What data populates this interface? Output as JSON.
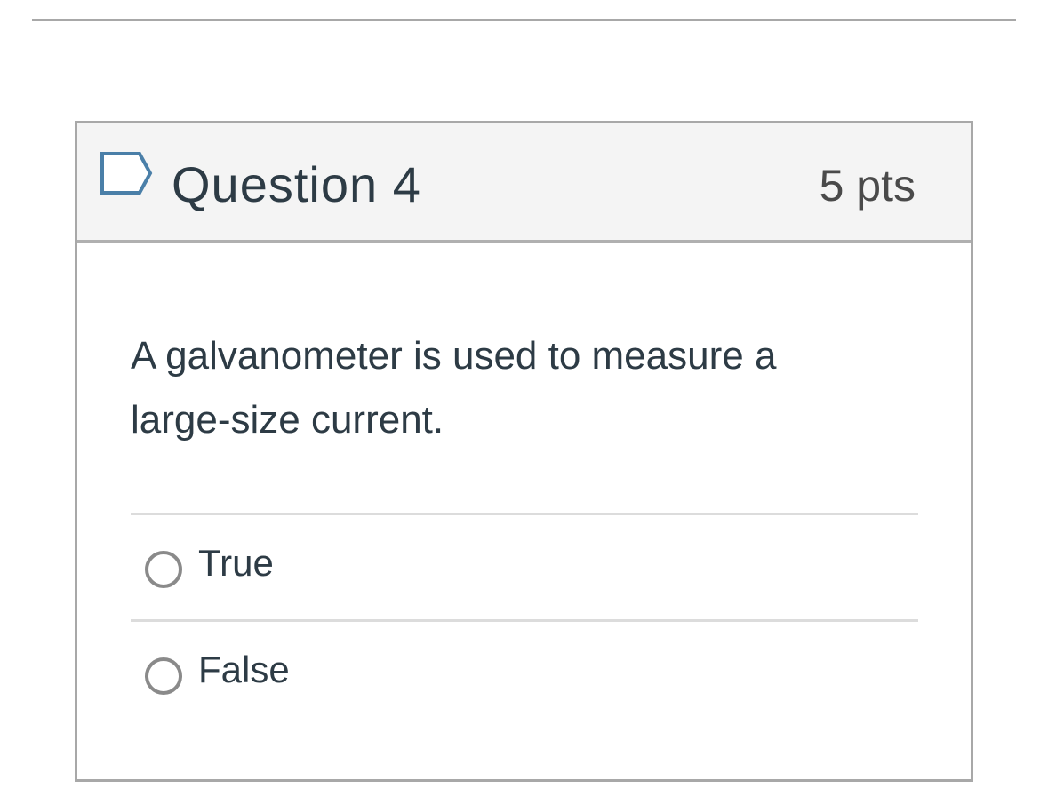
{
  "question": {
    "title": "Question 4",
    "points": "5 pts",
    "text": "A galvanometer is used to measure a large-size current.",
    "flag_icon": "flag-outline-icon"
  },
  "answers": [
    {
      "label": "True",
      "selected": false
    },
    {
      "label": "False",
      "selected": false
    }
  ],
  "colors": {
    "header_bg": "#f4f4f4",
    "border": "#a8a8a8",
    "text": "#2d3b45",
    "radio": "#8a8a8a",
    "flag": "#4a7fa8"
  }
}
